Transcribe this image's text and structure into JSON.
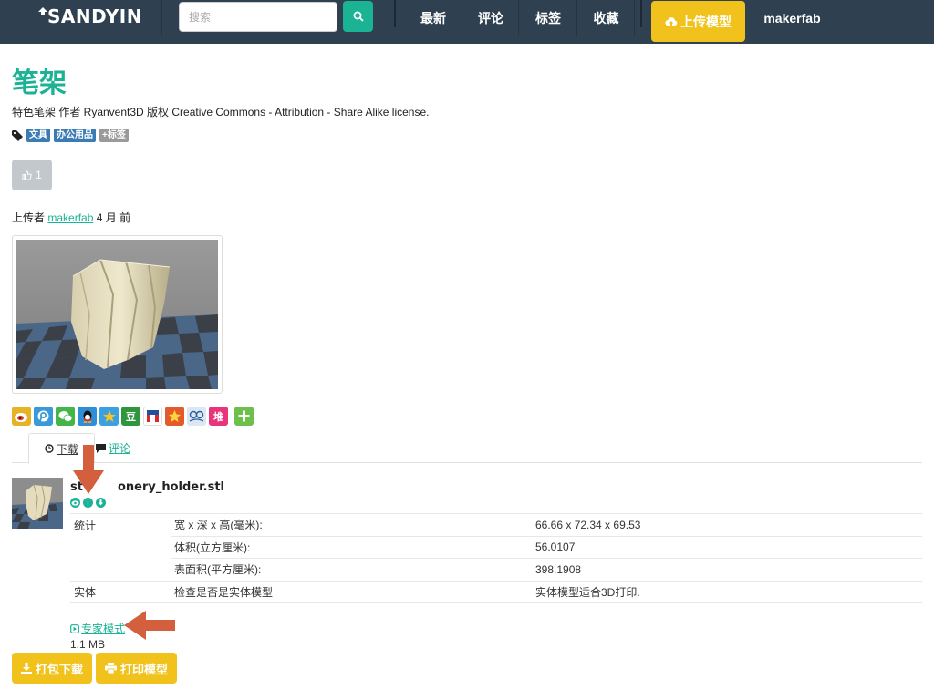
{
  "nav": {
    "logo": "SANDYIN",
    "search_placeholder": "搜索",
    "items": [
      "最新",
      "评论",
      "标签",
      "收藏"
    ],
    "upload_label": "上传模型",
    "username": "makerfab"
  },
  "model": {
    "title": "笔架",
    "description": "特色笔架 作者 Ryanvent3D 版权 Creative Commons - Attribution - Share Alike license.",
    "tags": [
      "文具",
      "办公用品"
    ],
    "add_tag_label": "+标签",
    "likes": "1",
    "uploaded_by_prefix": "上传者",
    "uploader": "makerfab",
    "uploaded_time": "4 月 前"
  },
  "share_icons": [
    "weibo-icon",
    "tencent-weibo-icon",
    "wechat-icon",
    "qq-icon",
    "qzone-icon",
    "douban-icon",
    "renren-icon",
    "kaixin-icon",
    "people-icon",
    "tieba-icon",
    "more-share-icon"
  ],
  "tabs": {
    "download": "下载",
    "comments": "评论"
  },
  "file": {
    "name": "stationery_holder.stl",
    "name_visible_prefix": "st",
    "name_visible_suffix": "onery_holder.stl",
    "stats": [
      {
        "category": "统计",
        "label": "宽 x 深 x 高(毫米):",
        "value": "66.66 x 72.34 x 69.53"
      },
      {
        "category": "",
        "label": "体积(立方厘米):",
        "value": "56.0107"
      },
      {
        "category": "",
        "label": "表面积(平方厘米):",
        "value": "398.1908"
      },
      {
        "category": "实体",
        "label": "检查是否是实体模型",
        "value": "实体模型适合3D打印."
      }
    ],
    "expert_mode": "专家模式",
    "size": "1.1 MB"
  },
  "actions": {
    "download_zip": "打包下载",
    "print_model": "打印模型"
  },
  "colors": {
    "nav_bg": "#2f4050",
    "accent": "#1ab394",
    "yellow": "#f1c21b",
    "tag_blue": "#3c7cb5",
    "annotation_arrow": "#d35f3c"
  }
}
